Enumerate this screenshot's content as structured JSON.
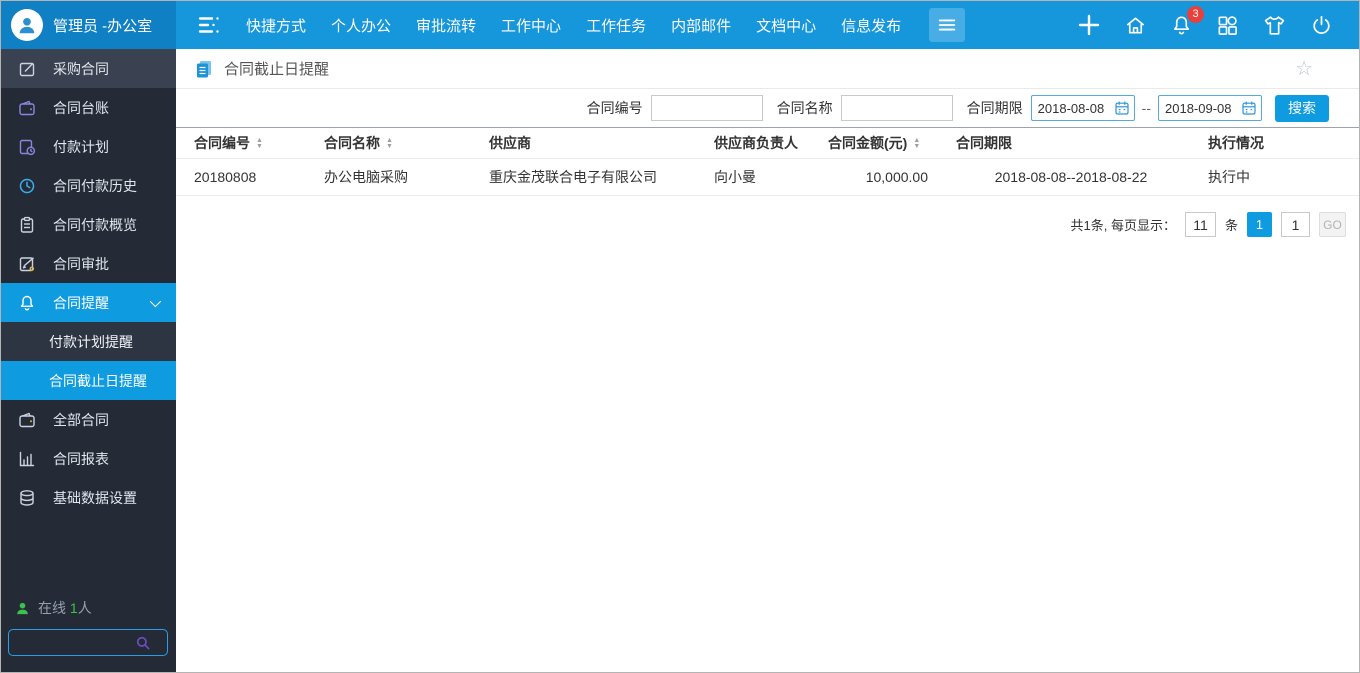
{
  "user": {
    "name": "管理员 -办公室"
  },
  "topnav": {
    "items": [
      {
        "label": "快捷方式"
      },
      {
        "label": "个人办公"
      },
      {
        "label": "审批流转"
      },
      {
        "label": "工作中心"
      },
      {
        "label": "工作任务"
      },
      {
        "label": "内部邮件"
      },
      {
        "label": "文档中心"
      },
      {
        "label": "信息发布"
      }
    ],
    "badge_count": "3",
    "icons": [
      "collapse-menu-icon",
      "hamburger-icon",
      "plus-icon",
      "home-icon",
      "bell-icon",
      "apps-grid-icon",
      "shirt-icon",
      "power-icon"
    ]
  },
  "sidebar": {
    "items": [
      {
        "label": "采购合同",
        "icon": "edit-document-icon"
      },
      {
        "label": "合同台账",
        "icon": "wallet-icon"
      },
      {
        "label": "付款计划",
        "icon": "payment-plan-icon"
      },
      {
        "label": "合同付款历史",
        "icon": "clock-icon"
      },
      {
        "label": "合同付款概览",
        "icon": "clipboard-icon"
      },
      {
        "label": "合同审批",
        "icon": "document-pen-icon"
      },
      {
        "label": "合同提醒",
        "icon": "bell-icon",
        "expanded": true
      },
      {
        "label": "付款计划提醒",
        "sub": true
      },
      {
        "label": "合同截止日提醒",
        "sub": true,
        "active": true
      },
      {
        "label": "全部合同",
        "icon": "wallet-icon"
      },
      {
        "label": "合同报表",
        "icon": "chart-icon"
      },
      {
        "label": "基础数据设置",
        "icon": "database-icon"
      }
    ],
    "online": {
      "prefix": "在线",
      "count": "1",
      "suffix": "人"
    }
  },
  "breadcrumb": {
    "title": "合同截止日提醒"
  },
  "filters": {
    "contract_no_label": "合同编号",
    "contract_name_label": "合同名称",
    "contract_period_label": "合同期限",
    "date_from": "2018-08-08",
    "date_to": "2018-09-08",
    "range_separator": "--",
    "search_label": "搜索"
  },
  "table": {
    "columns": [
      {
        "label": "合同编号",
        "sortable": true
      },
      {
        "label": "合同名称",
        "sortable": true
      },
      {
        "label": "供应商",
        "sortable": false
      },
      {
        "label": "供应商负责人",
        "sortable": false
      },
      {
        "label": "合同金额(元)",
        "sortable": true
      },
      {
        "label": "合同期限",
        "sortable": false
      },
      {
        "label": "执行情况",
        "sortable": false
      }
    ],
    "rows": [
      [
        "20180808",
        "办公电脑采购",
        "重庆金茂联合电子有限公司",
        "向小曼",
        "10,000.00",
        "2018-08-08--2018-08-22",
        "执行中"
      ]
    ]
  },
  "pagination": {
    "summary": "共1条, 每页显示：",
    "page_size": "11",
    "unit": "条",
    "current_page": "1",
    "goto_value": "1",
    "go_label": "GO"
  },
  "colors": {
    "topbar_blue": "#1697dc",
    "userblock_blue": "#1080c5",
    "accent_blue": "#0f9be0",
    "sidebar_bg": "#242b37",
    "sidebar_item_first_bg": "#3a4150",
    "sidebar_subitem_bg": "#2d3442",
    "badge_red": "#e8403b",
    "online_green": "#3cc14e",
    "icon_purple": "#8d85dd",
    "icon_cyan": "#38b0ea"
  }
}
